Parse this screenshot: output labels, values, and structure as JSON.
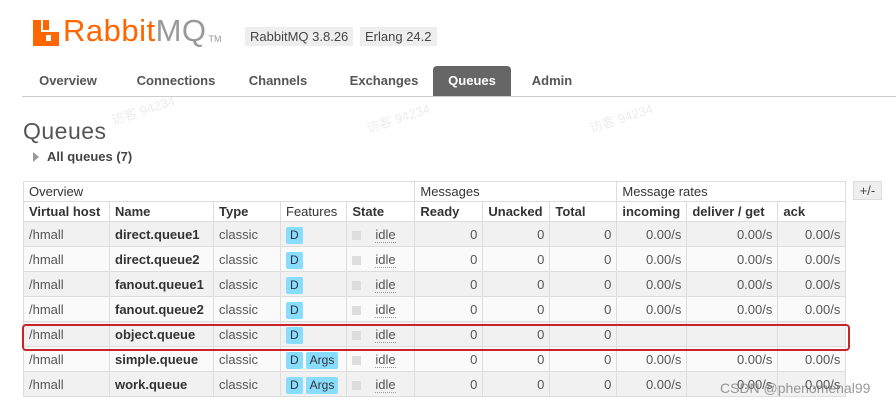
{
  "brand": {
    "name_rabbit": "Rabbit",
    "name_mq": "MQ",
    "tm": "TM"
  },
  "versions": {
    "rabbitmq": "RabbitMQ 3.8.26",
    "erlang": "Erlang 24.2"
  },
  "nav": {
    "tabs": [
      "Overview",
      "Connections",
      "Channels",
      "Exchanges",
      "Queues",
      "Admin"
    ],
    "active": "Queues"
  },
  "page": {
    "title": "Queues",
    "section_label": "All queues (7)",
    "toggle_columns": "+/-"
  },
  "table": {
    "groups": [
      "Overview",
      "Messages",
      "Message rates"
    ],
    "columns": [
      "Virtual host",
      "Name",
      "Type",
      "Features",
      "State",
      "Ready",
      "Unacked",
      "Total",
      "incoming",
      "deliver / get",
      "ack"
    ],
    "rows": [
      {
        "vhost": "/hmall",
        "name": "direct.queue1",
        "type": "classic",
        "features": [
          "D"
        ],
        "state": "idle",
        "ready": "0",
        "unacked": "0",
        "total": "0",
        "incoming": "0.00/s",
        "deliver": "0.00/s",
        "ack": "0.00/s"
      },
      {
        "vhost": "/hmall",
        "name": "direct.queue2",
        "type": "classic",
        "features": [
          "D"
        ],
        "state": "idle",
        "ready": "0",
        "unacked": "0",
        "total": "0",
        "incoming": "0.00/s",
        "deliver": "0.00/s",
        "ack": "0.00/s"
      },
      {
        "vhost": "/hmall",
        "name": "fanout.queue1",
        "type": "classic",
        "features": [
          "D"
        ],
        "state": "idle",
        "ready": "0",
        "unacked": "0",
        "total": "0",
        "incoming": "0.00/s",
        "deliver": "0.00/s",
        "ack": "0.00/s"
      },
      {
        "vhost": "/hmall",
        "name": "fanout.queue2",
        "type": "classic",
        "features": [
          "D"
        ],
        "state": "idle",
        "ready": "0",
        "unacked": "0",
        "total": "0",
        "incoming": "0.00/s",
        "deliver": "0.00/s",
        "ack": "0.00/s"
      },
      {
        "vhost": "/hmall",
        "name": "object.queue",
        "type": "classic",
        "features": [
          "D"
        ],
        "state": "idle",
        "ready": "0",
        "unacked": "0",
        "total": "0",
        "incoming": "",
        "deliver": "",
        "ack": ""
      },
      {
        "vhost": "/hmall",
        "name": "simple.queue",
        "type": "classic",
        "features": [
          "D",
          "Args"
        ],
        "state": "idle",
        "ready": "0",
        "unacked": "0",
        "total": "0",
        "incoming": "0.00/s",
        "deliver": "0.00/s",
        "ack": "0.00/s"
      },
      {
        "vhost": "/hmall",
        "name": "work.queue",
        "type": "classic",
        "features": [
          "D",
          "Args"
        ],
        "state": "idle",
        "ready": "0",
        "unacked": "0",
        "total": "0",
        "incoming": "0.00/s",
        "deliver": "0.00/s",
        "ack": "0.00/s"
      }
    ]
  },
  "watermark": {
    "text": "访客 94234",
    "csdn": "CSDN @phenomenal99"
  },
  "colors": {
    "brand_orange": "#ff6600",
    "active_tab": "#666666",
    "feature_badge": "#88ddff",
    "highlight": "#c9242a"
  }
}
